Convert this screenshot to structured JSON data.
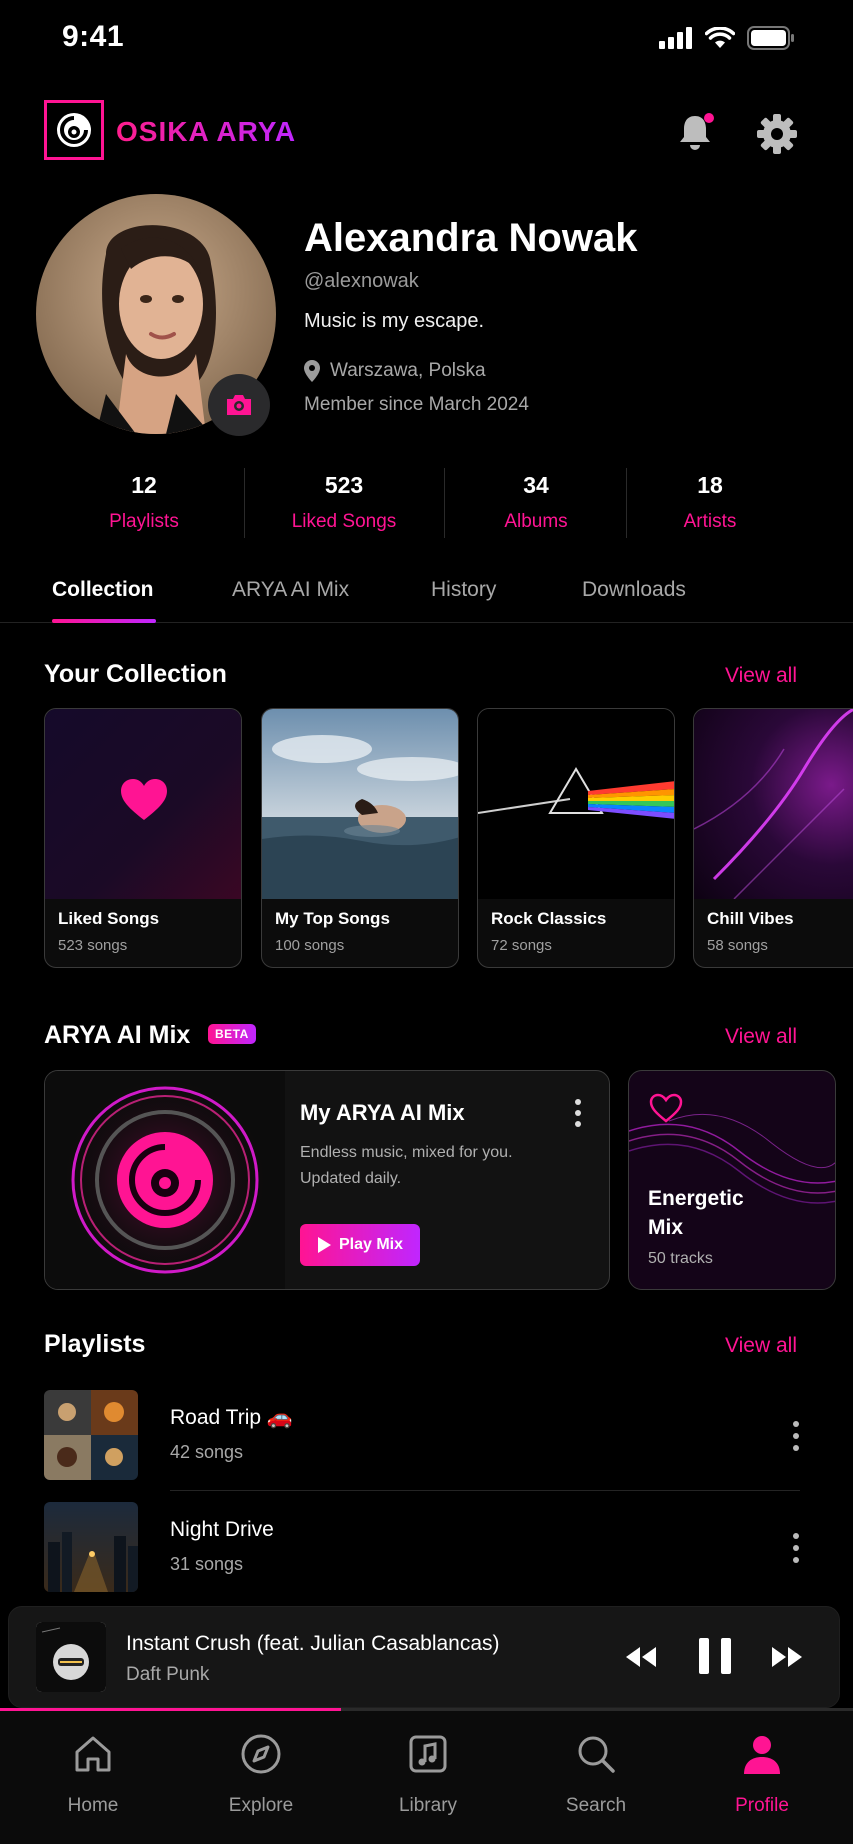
{
  "status_bar": {
    "time": "9:41"
  },
  "header": {
    "app_name": "OSIKA ARYA",
    "notification_dot": true
  },
  "profile": {
    "name": "Alexandra Nowak",
    "handle": "@alexnowak",
    "bio": "Music is my escape.",
    "location": "Warszawa, Polska",
    "member_since": "Member since March 2024"
  },
  "stats": [
    {
      "value": "12",
      "label": "Playlists"
    },
    {
      "value": "523",
      "label": "Liked Songs"
    },
    {
      "value": "34",
      "label": "Albums"
    },
    {
      "value": "18",
      "label": "Artists"
    }
  ],
  "tabs": [
    {
      "label": "Collection",
      "active": true
    },
    {
      "label": "ARYA AI Mix",
      "active": false
    },
    {
      "label": "History",
      "active": false
    },
    {
      "label": "Downloads",
      "active": false
    }
  ],
  "collection": {
    "title": "Your Collection",
    "view_all": "View all",
    "cards": [
      {
        "title": "Liked Songs",
        "count": "523 songs"
      },
      {
        "title": "My Top Songs",
        "count": "100 songs"
      },
      {
        "title": "Rock Classics",
        "count": "72 songs"
      },
      {
        "title": "Chill Vibes",
        "count": "58 songs"
      }
    ]
  },
  "ai_mix": {
    "title": "ARYA AI Mix",
    "badge": "BETA",
    "view_all": "View all",
    "main": {
      "title": "My ARYA AI Mix",
      "line1": "Endless music, mixed for you.",
      "line2": "Updated daily.",
      "button": "Play Mix"
    },
    "secondary": {
      "title": "Energetic Mix",
      "count": "50 tracks"
    }
  },
  "playlists": {
    "title": "Playlists",
    "view_all": "View all",
    "items": [
      {
        "name": "Road Trip 🚗",
        "count": "42 songs"
      },
      {
        "name": "Night Drive",
        "count": "31 songs"
      }
    ]
  },
  "now_playing": {
    "title": "Instant Crush (feat. Julian Casablancas)",
    "artist": "Daft Punk",
    "progress": 0.4
  },
  "nav": [
    {
      "label": "Home",
      "icon": "home-icon",
      "active": false
    },
    {
      "label": "Explore",
      "icon": "compass-icon",
      "active": false
    },
    {
      "label": "Library",
      "icon": "library-icon",
      "active": false
    },
    {
      "label": "Search",
      "icon": "search-icon",
      "active": false
    },
    {
      "label": "Profile",
      "icon": "profile-icon",
      "active": true
    }
  ],
  "colors": {
    "accent": "#ff1493",
    "accent2": "#c026ff",
    "background": "#000000"
  }
}
